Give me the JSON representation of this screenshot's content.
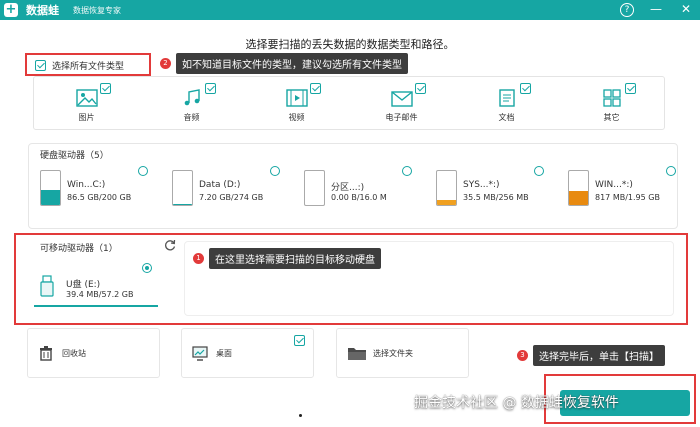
{
  "titlebar": {
    "brand": "数据蛙",
    "subtitle": "数据恢复专家",
    "help_icon": "question-icon",
    "min_icon": "minimize-icon",
    "close_icon": "close-icon"
  },
  "heading": "选择要扫描的丢失数据的数据类型和路径。",
  "select_all": {
    "label": "选择所有文件类型",
    "checked": true
  },
  "callouts": [
    {
      "num": "2",
      "text": "如不知道目标文件的类型，建议勾选所有文件类型"
    },
    {
      "num": "1",
      "text": "在这里选择需要扫描的目标移动硬盘"
    },
    {
      "num": "3",
      "text": "选择完毕后，单击【扫描】"
    }
  ],
  "file_types": [
    {
      "label": "图片",
      "icon": "image-icon",
      "checked": true
    },
    {
      "label": "音频",
      "icon": "music-icon",
      "checked": true
    },
    {
      "label": "视频",
      "icon": "video-icon",
      "checked": true
    },
    {
      "label": "电子邮件",
      "icon": "email-icon",
      "checked": true
    },
    {
      "label": "文档",
      "icon": "document-icon",
      "checked": true
    },
    {
      "label": "其它",
      "icon": "grid-icon",
      "checked": true
    }
  ],
  "hard_drives": {
    "title": "硬盘驱动器（5）",
    "items": [
      {
        "name": "Win...C:)",
        "size": "86.5 GB/200 GB",
        "fill": 0.43,
        "color": "#16a6a3"
      },
      {
        "name": "Data (D:)",
        "size": "7.20 GB/274 GB",
        "fill": 0.03,
        "color": "#16a6a3"
      },
      {
        "name": "分区...:)",
        "size": "0.00  B/16.0 M",
        "fill": 0.0,
        "color": "#16a6a3"
      },
      {
        "name": "SYS...*:)",
        "size": "35.5 MB/256 MB",
        "fill": 0.14,
        "color": "#f0a020"
      },
      {
        "name": "WIN...*:)",
        "size": "817 MB/1.95 GB",
        "fill": 0.42,
        "color": "#e88a10"
      }
    ]
  },
  "removable": {
    "title": "可移动驱动器（1）",
    "refresh_icon": "refresh-icon",
    "items": [
      {
        "name": "U盘 (E:)",
        "size": "39.4 MB/57.2 GB",
        "selected": true
      }
    ]
  },
  "locations": [
    {
      "label": "回收站",
      "icon": "trash-icon"
    },
    {
      "label": "桌面",
      "icon": "desktop-icon"
    },
    {
      "label": "选择文件夹",
      "icon": "folder-icon"
    }
  ],
  "watermark": "掘金技术社区 @ 数据蛙恢复软件",
  "colors": {
    "accent": "#16a6a3",
    "annotation": "#e23a3a"
  }
}
